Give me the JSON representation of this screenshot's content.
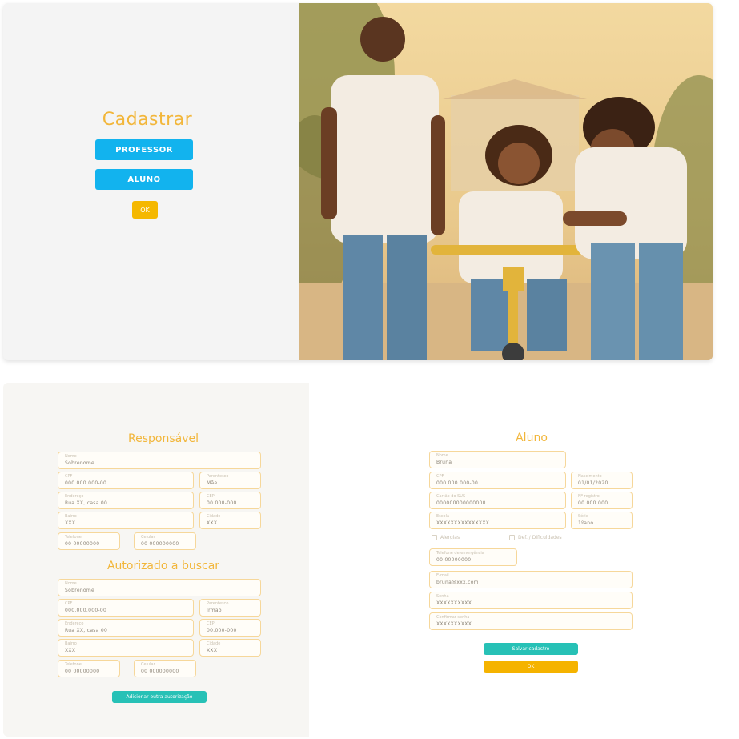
{
  "register": {
    "title": "Cadastrar",
    "teacher_button": "PROFESSOR",
    "student_button": "ALUNO",
    "ok_button": "OK"
  },
  "responsavel": {
    "title": "Responsável",
    "fields": [
      {
        "label": "Nome",
        "value": "Sobrenome"
      },
      {
        "label": "CPF",
        "value": "000.000.000-00"
      },
      {
        "label": "Parentesco",
        "value": "Mãe"
      },
      {
        "label": "Endereço",
        "value": "Rua XX, casa 00"
      },
      {
        "label": "CEP",
        "value": "00.000-000"
      },
      {
        "label": "Bairro",
        "value": "XXX"
      },
      {
        "label": "Cidade",
        "value": "XXX"
      },
      {
        "label": "Telefone",
        "value": "00 00000000"
      },
      {
        "label": "Celular",
        "value": "00 000000000"
      }
    ]
  },
  "autorizado": {
    "title": "Autorizado a buscar",
    "fields": [
      {
        "label": "Nome",
        "value": "Sobrenome"
      },
      {
        "label": "CPF",
        "value": "000.000.000-00"
      },
      {
        "label": "Parentesco",
        "value": "Irmão"
      },
      {
        "label": "Endereço",
        "value": "Rua XX, casa 00"
      },
      {
        "label": "CEP",
        "value": "00.000-000"
      },
      {
        "label": "Bairro",
        "value": "XXX"
      },
      {
        "label": "Cidade",
        "value": "XXX"
      },
      {
        "label": "Telefone",
        "value": "00 00000000"
      },
      {
        "label": "Celular",
        "value": "00 000000000"
      }
    ],
    "add_button": "Adicionar outra autorização"
  },
  "aluno": {
    "title": "Aluno",
    "fields": [
      {
        "label": "Nome",
        "value": "Bruna"
      },
      {
        "label": "CPF",
        "value": "000.000.000-00"
      },
      {
        "label": "Nascimento",
        "value": "01/01/2020"
      },
      {
        "label": "Cartão do SUS",
        "value": "000000000000000"
      },
      {
        "label": "Nº registro",
        "value": "00.000.000"
      },
      {
        "label": "Escola",
        "value": "XXXXXXXXXXXXXXX"
      },
      {
        "label": "Série",
        "value": "1ºano"
      },
      {
        "label": "Telefone de emergência",
        "value": "00 00000000"
      },
      {
        "label": "E-mail",
        "value": "bruna@xxx.com"
      },
      {
        "label": "Senha",
        "value": "XXXXXXXXXX"
      },
      {
        "label": "Confirmar senha",
        "value": "XXXXXXXXXX"
      }
    ],
    "checks": [
      "Alergias",
      "Def. / Dificuldades"
    ],
    "teal_button": "Salvar cadastro",
    "orange_button": "OK"
  }
}
